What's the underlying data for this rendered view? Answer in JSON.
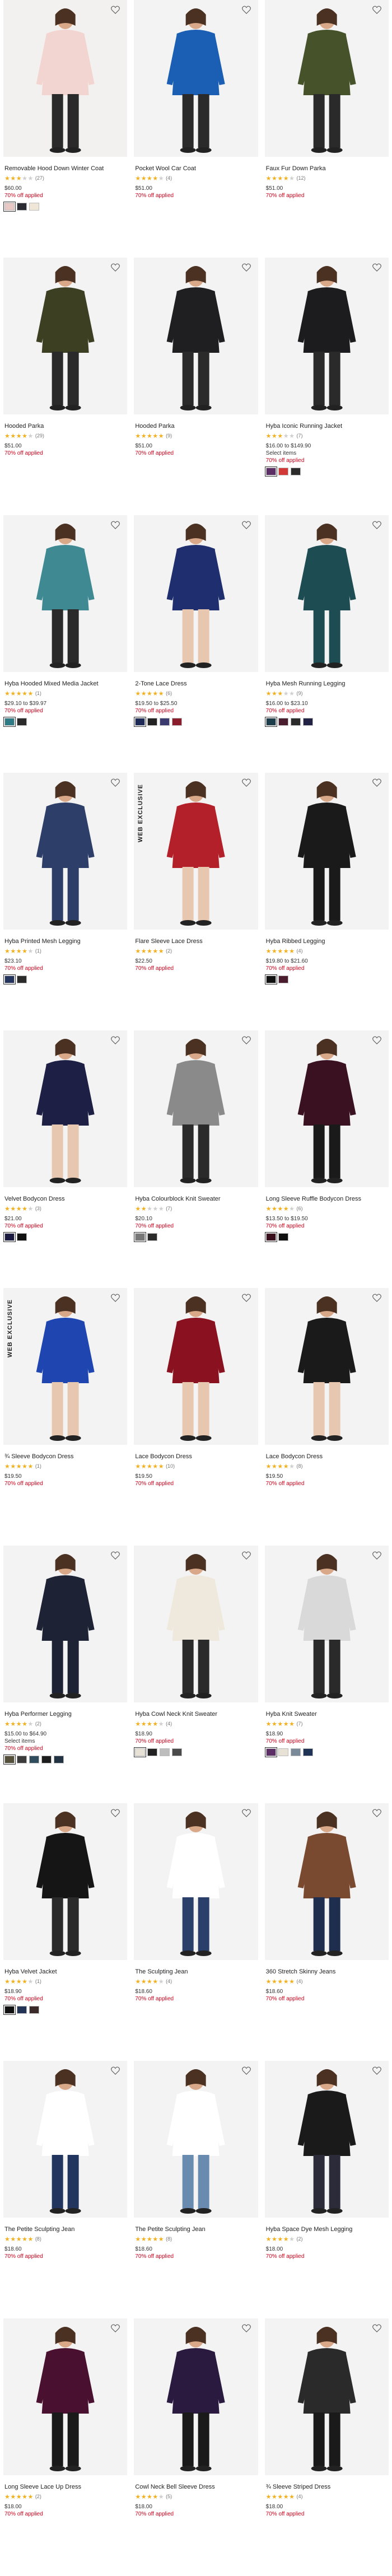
{
  "products": [
    {
      "name": "Removable Hood Down Winter Coat",
      "rating": 3,
      "reviews": "(27)",
      "price": "$60.00",
      "promo": "70% off applied",
      "select": "",
      "badge": "",
      "swatches": [
        "#e8c8c4",
        "#2b2b33",
        "#f0e6d8"
      ],
      "palette": {
        "bg": "#f3f1ef",
        "cloth": "#f2d5d0",
        "legs": "#2a2a2a"
      }
    },
    {
      "name": "Pocket Wool Car Coat",
      "rating": 4,
      "reviews": "(4)",
      "price": "$51.00",
      "promo": "70% off applied",
      "select": "",
      "badge": "",
      "swatches": [],
      "palette": {
        "bg": "#f3f3f3",
        "cloth": "#1b5fb4",
        "legs": "#2a2a2a"
      }
    },
    {
      "name": "Faux Fur Down Parka",
      "rating": 4,
      "reviews": "(12)",
      "price": "$51.00",
      "promo": "70% off applied",
      "select": "",
      "badge": "",
      "swatches": [],
      "palette": {
        "bg": "#f3f3f3",
        "cloth": "#46532a",
        "legs": "#2a2a2a"
      }
    },
    {
      "name": "Hooded Parka",
      "rating": 4,
      "reviews": "(29)",
      "price": "$51.00",
      "promo": "70% off applied",
      "select": "",
      "badge": "",
      "swatches": [],
      "palette": {
        "bg": "#f3f3f3",
        "cloth": "#3c3f22",
        "legs": "#2a2a2a"
      }
    },
    {
      "name": "Hooded Parka",
      "rating": 5,
      "reviews": "(9)",
      "price": "$51.00",
      "promo": "70% off applied",
      "select": "",
      "badge": "",
      "swatches": [],
      "palette": {
        "bg": "#f3f3f3",
        "cloth": "#1f1f22",
        "legs": "#2a2a2a"
      }
    },
    {
      "name": "Hyba Iconic Running Jacket",
      "rating": 3,
      "reviews": "(7)",
      "price": "$16.00 to $149.90",
      "promo": "70% off applied",
      "select": "Select items",
      "badge": "",
      "swatches": [
        "#5b2e66",
        "#d23a3a",
        "#2b2b2b"
      ],
      "palette": {
        "bg": "#f3f3f3",
        "cloth": "#1c1c1e",
        "legs": "#2a2a2a"
      }
    },
    {
      "name": "Hyba Hooded Mixed Media Jacket",
      "rating": 5,
      "reviews": "(1)",
      "price": "$29.10 to $39.97",
      "promo": "70% off applied",
      "select": "",
      "badge": "",
      "swatches": [
        "#2f7b85",
        "#2b2b2b"
      ],
      "palette": {
        "bg": "#f3f3f3",
        "cloth": "#3f8a92",
        "legs": "#2a2a2a"
      }
    },
    {
      "name": "2-Tone Lace Dress",
      "rating": 5,
      "reviews": "(6)",
      "price": "$19.50 to $25.50",
      "promo": "70% off applied",
      "select": "",
      "badge": "",
      "swatches": [
        "#1d2a55",
        "#222222",
        "#3b3b70",
        "#8a1d2c"
      ],
      "palette": {
        "bg": "#f3f3f3",
        "cloth": "#1f2e6e",
        "legs": "#e8c7b0"
      }
    },
    {
      "name": "Hyba Mesh Running Legging",
      "rating": 3,
      "reviews": "(9)",
      "price": "$16.00 to $23.10",
      "promo": "70% off applied",
      "select": "",
      "badge": "",
      "swatches": [
        "#1d3d4a",
        "#4a1d2e",
        "#2b2b2b",
        "#222244"
      ],
      "palette": {
        "bg": "#f3f3f3",
        "cloth": "#1d4c52",
        "legs": "#1d4c52"
      }
    },
    {
      "name": "Hyba Printed Mesh Legging",
      "rating": 4,
      "reviews": "(1)",
      "price": "$23.10",
      "promo": "70% off applied",
      "select": "",
      "badge": "",
      "swatches": [
        "#25345c",
        "#2b2b2b"
      ],
      "palette": {
        "bg": "#f3f3f3",
        "cloth": "#2d3e68",
        "legs": "#2d3e68"
      }
    },
    {
      "name": "Flare Sleeve Lace Dress",
      "rating": 5,
      "reviews": "(2)",
      "price": "$22.50",
      "promo": "70% off applied",
      "select": "",
      "badge": "WEB EXCLUSIVE",
      "swatches": [],
      "palette": {
        "bg": "#f3f3f3",
        "cloth": "#b4202a",
        "legs": "#e8c7b0"
      }
    },
    {
      "name": "Hyba Ribbed Legging",
      "rating": 5,
      "reviews": "(4)",
      "price": "$19.80 to $21.60",
      "promo": "70% off applied",
      "select": "",
      "badge": "",
      "swatches": [
        "#111111",
        "#4a1d2e"
      ],
      "palette": {
        "bg": "#f3f3f3",
        "cloth": "#1a1a1a",
        "legs": "#1a1a1a"
      }
    },
    {
      "name": "Velvet Bodycon Dress",
      "rating": 4,
      "reviews": "(3)",
      "price": "$21.00",
      "promo": "70% off applied",
      "select": "",
      "badge": "",
      "swatches": [
        "#1a1a40",
        "#111111"
      ],
      "palette": {
        "bg": "#f3f3f3",
        "cloth": "#1e1f45",
        "legs": "#e8c7b0"
      }
    },
    {
      "name": "Hyba Colourblock Knit Sweater",
      "rating": 2,
      "reviews": "(7)",
      "price": "$20.10",
      "promo": "70% off applied",
      "select": "",
      "badge": "",
      "swatches": [
        "#777777",
        "#2b2b2b"
      ],
      "palette": {
        "bg": "#f3f3f3",
        "cloth": "#8a8a8a",
        "legs": "#2a2a2a"
      }
    },
    {
      "name": "Long Sleeve Ruffle Bodycon Dress",
      "rating": 4,
      "reviews": "(6)",
      "price": "$13.50 to $19.50",
      "promo": "70% off applied",
      "select": "",
      "badge": "",
      "swatches": [
        "#3a0f1c",
        "#111111"
      ],
      "palette": {
        "bg": "#f3f3f3",
        "cloth": "#3a1120",
        "legs": "#1a1a1a"
      }
    },
    {
      "name": "¾ Sleeve Bodycon Dress",
      "rating": 5,
      "reviews": "(1)",
      "price": "$19.50",
      "promo": "70% off applied",
      "select": "",
      "badge": "WEB EXCLUSIVE",
      "swatches": [],
      "palette": {
        "bg": "#f3f3f3",
        "cloth": "#1f45b0",
        "legs": "#e8c7b0"
      }
    },
    {
      "name": "Lace Bodycon Dress",
      "rating": 5,
      "reviews": "(10)",
      "price": "$19.50",
      "promo": "70% off applied",
      "select": "",
      "badge": "",
      "swatches": [],
      "palette": {
        "bg": "#f3f3f3",
        "cloth": "#8a1220",
        "legs": "#e8c7b0"
      }
    },
    {
      "name": "Lace Bodycon Dress",
      "rating": 4,
      "reviews": "(8)",
      "price": "$19.50",
      "promo": "70% off applied",
      "select": "",
      "badge": "",
      "swatches": [],
      "palette": {
        "bg": "#f3f3f3",
        "cloth": "#1a1a1a",
        "legs": "#e8c7b0"
      }
    },
    {
      "name": "Hyba Performer Legging",
      "rating": 4,
      "reviews": "(2)",
      "price": "$15.00 to $64.90",
      "promo": "70% off applied",
      "select": "Select items",
      "badge": "",
      "swatches": [
        "#55503b",
        "#3c3c3c",
        "#2f4d5c",
        "#1d1d1d",
        "#223344"
      ],
      "palette": {
        "bg": "#f3f3f3",
        "cloth": "#1e2235",
        "legs": "#1e2235"
      }
    },
    {
      "name": "Hyba Cowl Neck Knit Sweater",
      "rating": 4,
      "reviews": "(4)",
      "price": "$18.90",
      "promo": "70% off applied",
      "select": "",
      "badge": "",
      "swatches": [
        "#e8e2d6",
        "#222222",
        "#bdbdbd",
        "#4a4a4a"
      ],
      "palette": {
        "bg": "#f3f3f3",
        "cloth": "#efe9dd",
        "legs": "#2a2a2a"
      }
    },
    {
      "name": "Hyba Knit Sweater",
      "rating": 5,
      "reviews": "(7)",
      "price": "$18.90",
      "promo": "70% off applied",
      "select": "",
      "badge": "",
      "swatches": [
        "#5b2e66",
        "#e8e2d6",
        "#7a8a99",
        "#1f3355"
      ],
      "palette": {
        "bg": "#f3f3f3",
        "cloth": "#d9d9d9",
        "legs": "#2a2a2a"
      }
    },
    {
      "name": "Hyba Velvet Jacket",
      "rating": 4,
      "reviews": "(1)",
      "price": "$18.90",
      "promo": "70% off applied",
      "select": "",
      "badge": "",
      "swatches": [
        "#111111",
        "#223355",
        "#3a2a2a"
      ],
      "palette": {
        "bg": "#f3f3f3",
        "cloth": "#151515",
        "legs": "#2a2a2a"
      }
    },
    {
      "name": "The Sculpting Jean",
      "rating": 4,
      "reviews": "(4)",
      "price": "$18.60",
      "promo": "70% off applied",
      "select": "",
      "badge": "",
      "swatches": [],
      "palette": {
        "bg": "#f3f3f3",
        "cloth": "#ffffff",
        "legs": "#2a3f6a"
      }
    },
    {
      "name": "360 Stretch Skinny Jeans",
      "rating": 5,
      "reviews": "(4)",
      "price": "$18.60",
      "promo": "70% off applied",
      "select": "",
      "badge": "",
      "swatches": [],
      "palette": {
        "bg": "#f3f3f3",
        "cloth": "#7a4a30",
        "legs": "#1f2d4f"
      }
    },
    {
      "name": "The Petite Sculpting Jean",
      "rating": 5,
      "reviews": "(8)",
      "price": "$18.60",
      "promo": "70% off applied",
      "select": "",
      "badge": "",
      "swatches": [],
      "palette": {
        "bg": "#f3f3f3",
        "cloth": "#ffffff",
        "legs": "#22355e"
      }
    },
    {
      "name": "The Petite Sculpting Jean",
      "rating": 5,
      "reviews": "(8)",
      "price": "$18.60",
      "promo": "70% off applied",
      "select": "",
      "badge": "",
      "swatches": [],
      "palette": {
        "bg": "#f3f3f3",
        "cloth": "#ffffff",
        "legs": "#6a8bb0"
      }
    },
    {
      "name": "Hyba Space Dye Mesh Legging",
      "rating": 4,
      "reviews": "(2)",
      "price": "$18.00",
      "promo": "70% off applied",
      "select": "",
      "badge": "",
      "swatches": [],
      "palette": {
        "bg": "#f3f3f3",
        "cloth": "#1a1a1a",
        "legs": "#2b2b3a"
      }
    },
    {
      "name": "Long Sleeve Lace Up Dress",
      "rating": 5,
      "reviews": "(2)",
      "price": "$18.00",
      "promo": "70% off applied",
      "select": "",
      "badge": "",
      "swatches": [],
      "palette": {
        "bg": "#f3f3f3",
        "cloth": "#4a1030",
        "legs": "#1a1a1a"
      }
    },
    {
      "name": "Cowl Neck Bell Sleeve Dress",
      "rating": 4,
      "reviews": "(5)",
      "price": "$18.00",
      "promo": "70% off applied",
      "select": "",
      "badge": "",
      "swatches": [],
      "palette": {
        "bg": "#f3f3f3",
        "cloth": "#2a1a40",
        "legs": "#1a1a1a"
      }
    },
    {
      "name": "¾ Sleeve Striped Dress",
      "rating": 5,
      "reviews": "(4)",
      "price": "$18.00",
      "promo": "70% off applied",
      "select": "",
      "badge": "",
      "swatches": [],
      "palette": {
        "bg": "#f3f3f3",
        "cloth": "#2a2a2a",
        "legs": "#1a1a1a"
      }
    }
  ]
}
